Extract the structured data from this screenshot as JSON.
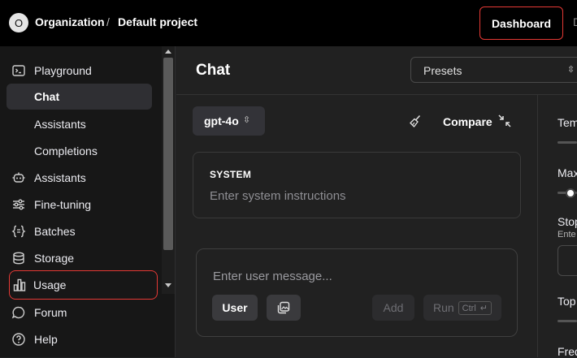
{
  "topbar": {
    "org_initial": "O",
    "org_name": "Organization",
    "separator": "/",
    "project_name": "Default project",
    "dashboard_label": "Dashboard",
    "tail_text": "D"
  },
  "sidebar": {
    "items": [
      {
        "label": "Playground",
        "icon": "terminal-icon"
      },
      {
        "label": "Chat",
        "icon": null,
        "active": true
      },
      {
        "label": "Assistants",
        "icon": null
      },
      {
        "label": "Completions",
        "icon": null
      },
      {
        "label": "Assistants",
        "icon": "robot-icon"
      },
      {
        "label": "Fine-tuning",
        "icon": "sliders-icon"
      },
      {
        "label": "Batches",
        "icon": "braces-icon"
      },
      {
        "label": "Storage",
        "icon": "database-icon"
      },
      {
        "label": "Usage",
        "icon": "bar-chart-icon"
      },
      {
        "label": "Forum",
        "icon": "chat-bubble-icon"
      },
      {
        "label": "Help",
        "icon": "help-circle-icon"
      }
    ]
  },
  "main": {
    "title": "Chat",
    "presets_label": "Presets",
    "model_label": "gpt-4o",
    "compare_label": "Compare",
    "system": {
      "label": "SYSTEM",
      "placeholder": "Enter system instructions"
    },
    "composer": {
      "placeholder": "Enter user message...",
      "role_label": "User",
      "add_label": "Add",
      "run_label": "Run",
      "shortcut_key": "Ctrl",
      "shortcut_enter": "↵"
    }
  },
  "right_panel": {
    "temperature_label": "Tem",
    "max_tokens_label": "Max",
    "stop_label": "Stop",
    "stop_sub": "Ente",
    "top_p_label": "Top",
    "freq_label": "Freq"
  },
  "colors": {
    "highlight_outline": "#e53935",
    "sidebar_bg": "#171717",
    "main_bg": "#212121",
    "topbar_bg": "#000000"
  }
}
